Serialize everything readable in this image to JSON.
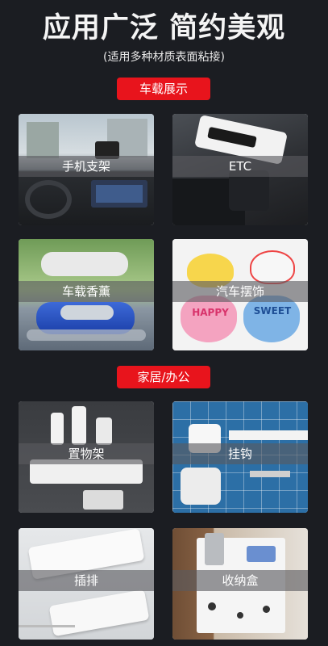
{
  "header": {
    "title": "应用广泛 简约美观",
    "subtitle": "(适用多种材质表面粘接)"
  },
  "sections": [
    {
      "badge": "车载展示",
      "cards": [
        {
          "label": "手机支架",
          "icon": "phone-holder-image"
        },
        {
          "label": "ETC",
          "icon": "etc-device-image"
        },
        {
          "label": "车载香薰",
          "icon": "car-aroma-image"
        },
        {
          "label": "汽车摆饰",
          "icon": "car-ornament-image",
          "decor_text": [
            "HAPPY",
            "SWEET"
          ]
        }
      ]
    },
    {
      "badge": "家居/办公",
      "cards": [
        {
          "label": "置物架",
          "icon": "storage-shelf-image"
        },
        {
          "label": "挂钩",
          "icon": "wall-hook-image"
        },
        {
          "label": "插排",
          "icon": "power-strip-image"
        },
        {
          "label": "收纳盒",
          "icon": "storage-box-image"
        }
      ]
    }
  ],
  "colors": {
    "background": "#1b1d22",
    "badge": "#e8141c",
    "label_overlay": "#5a5a5f"
  }
}
